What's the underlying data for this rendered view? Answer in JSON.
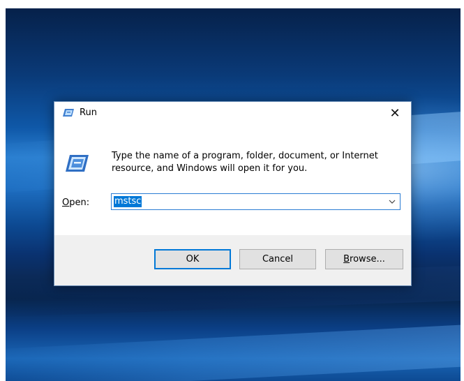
{
  "dialog": {
    "title": "Run",
    "close_glyph": "✕",
    "message": "Type the name of a program, folder, document, or Internet resource, and Windows will open it for you.",
    "open_label_accel": "O",
    "open_label_rest": "pen:",
    "open_value": "mstsc",
    "dropdown_glyph": "⌵",
    "buttons": {
      "ok": "OK",
      "cancel": "Cancel",
      "browse_accel": "B",
      "browse_rest": "rowse..."
    },
    "icons": {
      "title": "run-icon",
      "big": "run-icon",
      "close": "close-icon",
      "dropdown": "chevron-down-icon"
    }
  },
  "colors": {
    "accent": "#0078d7",
    "footer": "#f0f0f0",
    "button": "#e1e1e1"
  }
}
